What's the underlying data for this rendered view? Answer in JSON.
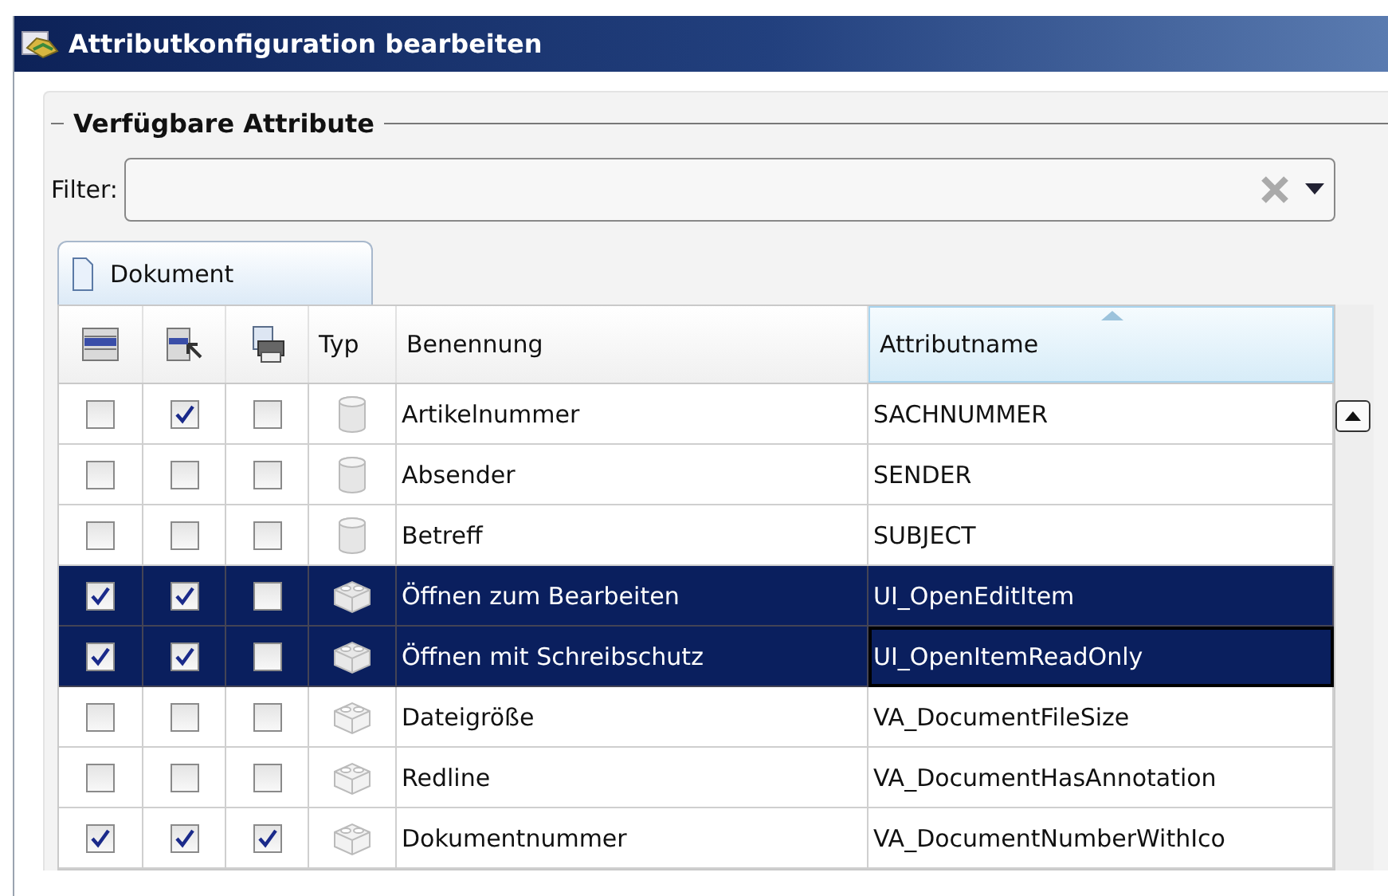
{
  "window": {
    "title": "Attributkonfiguration bearbeiten"
  },
  "group": {
    "title": "Verfügbare Attribute"
  },
  "filter": {
    "label": "Filter:"
  },
  "tabs": [
    {
      "label": "Dokument",
      "selected": true
    }
  ],
  "table": {
    "columns": [
      {
        "kind": "icon"
      },
      {
        "kind": "icon"
      },
      {
        "kind": "icon"
      },
      {
        "kind": "text",
        "label": "Typ",
        "sorted": false
      },
      {
        "kind": "text",
        "label": "Benennung",
        "sorted": false
      },
      {
        "kind": "text",
        "label": "Attributname",
        "sorted": true
      }
    ],
    "rows": [
      {
        "checks": [
          false,
          true,
          false
        ],
        "kind": "database",
        "name": "Artikelnummer",
        "attribute": "SACHNUMMER",
        "selected": false,
        "focused": false
      },
      {
        "checks": [
          false,
          false,
          false
        ],
        "kind": "database",
        "name": "Absender",
        "attribute": "SENDER",
        "selected": false,
        "focused": false
      },
      {
        "checks": [
          false,
          false,
          false
        ],
        "kind": "database",
        "name": "Betreff",
        "attribute": "SUBJECT",
        "selected": false,
        "focused": false
      },
      {
        "checks": [
          true,
          true,
          false
        ],
        "kind": "component",
        "name": "Öffnen zum Bearbeiten",
        "attribute": "UI_OpenEditItem",
        "selected": true,
        "focused": false
      },
      {
        "checks": [
          true,
          true,
          false
        ],
        "kind": "component",
        "name": "Öffnen mit Schreibschutz",
        "attribute": "UI_OpenItemReadOnly",
        "selected": true,
        "focused": true
      },
      {
        "checks": [
          false,
          false,
          false
        ],
        "kind": "component",
        "name": "Dateigröße",
        "attribute": "VA_DocumentFileSize",
        "selected": false,
        "focused": false
      },
      {
        "checks": [
          false,
          false,
          false
        ],
        "kind": "component",
        "name": "Redline",
        "attribute": "VA_DocumentHasAnnotation",
        "selected": false,
        "focused": false
      },
      {
        "checks": [
          true,
          true,
          true
        ],
        "kind": "component",
        "name": "Dokumentnummer",
        "attribute": "VA_DocumentNumberWithIco",
        "selected": false,
        "focused": false
      }
    ]
  }
}
